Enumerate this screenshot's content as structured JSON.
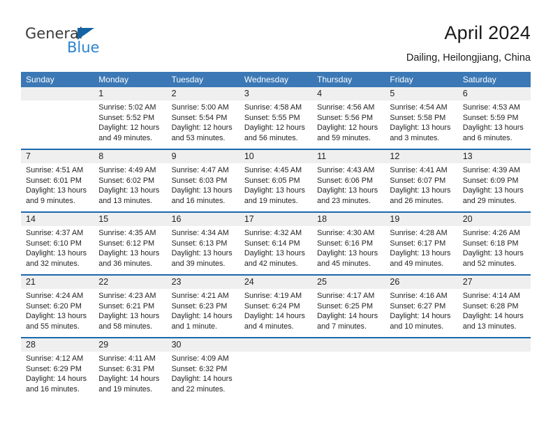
{
  "brand": {
    "name_top": "General",
    "name_bottom": "Blue",
    "triangle_color": "#1464a5",
    "blue_color": "#2a84d2"
  },
  "header": {
    "title": "April 2024",
    "subtitle": "Dailing, Heilongjiang, China"
  },
  "theme": {
    "header_bg": "#3b78b5",
    "row_divider": "#1b68ad",
    "daynum_bg": "#efefef",
    "text": "#222222"
  },
  "weekdays": [
    "Sunday",
    "Monday",
    "Tuesday",
    "Wednesday",
    "Thursday",
    "Friday",
    "Saturday"
  ],
  "weeks": [
    {
      "days": [
        {
          "num": "",
          "sunrise": "",
          "sunset": "",
          "daylight1": "",
          "daylight2": ""
        },
        {
          "num": "1",
          "sunrise": "Sunrise: 5:02 AM",
          "sunset": "Sunset: 5:52 PM",
          "daylight1": "Daylight: 12 hours",
          "daylight2": "and 49 minutes."
        },
        {
          "num": "2",
          "sunrise": "Sunrise: 5:00 AM",
          "sunset": "Sunset: 5:54 PM",
          "daylight1": "Daylight: 12 hours",
          "daylight2": "and 53 minutes."
        },
        {
          "num": "3",
          "sunrise": "Sunrise: 4:58 AM",
          "sunset": "Sunset: 5:55 PM",
          "daylight1": "Daylight: 12 hours",
          "daylight2": "and 56 minutes."
        },
        {
          "num": "4",
          "sunrise": "Sunrise: 4:56 AM",
          "sunset": "Sunset: 5:56 PM",
          "daylight1": "Daylight: 12 hours",
          "daylight2": "and 59 minutes."
        },
        {
          "num": "5",
          "sunrise": "Sunrise: 4:54 AM",
          "sunset": "Sunset: 5:58 PM",
          "daylight1": "Daylight: 13 hours",
          "daylight2": "and 3 minutes."
        },
        {
          "num": "6",
          "sunrise": "Sunrise: 4:53 AM",
          "sunset": "Sunset: 5:59 PM",
          "daylight1": "Daylight: 13 hours",
          "daylight2": "and 6 minutes."
        }
      ]
    },
    {
      "days": [
        {
          "num": "7",
          "sunrise": "Sunrise: 4:51 AM",
          "sunset": "Sunset: 6:01 PM",
          "daylight1": "Daylight: 13 hours",
          "daylight2": "and 9 minutes."
        },
        {
          "num": "8",
          "sunrise": "Sunrise: 4:49 AM",
          "sunset": "Sunset: 6:02 PM",
          "daylight1": "Daylight: 13 hours",
          "daylight2": "and 13 minutes."
        },
        {
          "num": "9",
          "sunrise": "Sunrise: 4:47 AM",
          "sunset": "Sunset: 6:03 PM",
          "daylight1": "Daylight: 13 hours",
          "daylight2": "and 16 minutes."
        },
        {
          "num": "10",
          "sunrise": "Sunrise: 4:45 AM",
          "sunset": "Sunset: 6:05 PM",
          "daylight1": "Daylight: 13 hours",
          "daylight2": "and 19 minutes."
        },
        {
          "num": "11",
          "sunrise": "Sunrise: 4:43 AM",
          "sunset": "Sunset: 6:06 PM",
          "daylight1": "Daylight: 13 hours",
          "daylight2": "and 23 minutes."
        },
        {
          "num": "12",
          "sunrise": "Sunrise: 4:41 AM",
          "sunset": "Sunset: 6:07 PM",
          "daylight1": "Daylight: 13 hours",
          "daylight2": "and 26 minutes."
        },
        {
          "num": "13",
          "sunrise": "Sunrise: 4:39 AM",
          "sunset": "Sunset: 6:09 PM",
          "daylight1": "Daylight: 13 hours",
          "daylight2": "and 29 minutes."
        }
      ]
    },
    {
      "days": [
        {
          "num": "14",
          "sunrise": "Sunrise: 4:37 AM",
          "sunset": "Sunset: 6:10 PM",
          "daylight1": "Daylight: 13 hours",
          "daylight2": "and 32 minutes."
        },
        {
          "num": "15",
          "sunrise": "Sunrise: 4:35 AM",
          "sunset": "Sunset: 6:12 PM",
          "daylight1": "Daylight: 13 hours",
          "daylight2": "and 36 minutes."
        },
        {
          "num": "16",
          "sunrise": "Sunrise: 4:34 AM",
          "sunset": "Sunset: 6:13 PM",
          "daylight1": "Daylight: 13 hours",
          "daylight2": "and 39 minutes."
        },
        {
          "num": "17",
          "sunrise": "Sunrise: 4:32 AM",
          "sunset": "Sunset: 6:14 PM",
          "daylight1": "Daylight: 13 hours",
          "daylight2": "and 42 minutes."
        },
        {
          "num": "18",
          "sunrise": "Sunrise: 4:30 AM",
          "sunset": "Sunset: 6:16 PM",
          "daylight1": "Daylight: 13 hours",
          "daylight2": "and 45 minutes."
        },
        {
          "num": "19",
          "sunrise": "Sunrise: 4:28 AM",
          "sunset": "Sunset: 6:17 PM",
          "daylight1": "Daylight: 13 hours",
          "daylight2": "and 49 minutes."
        },
        {
          "num": "20",
          "sunrise": "Sunrise: 4:26 AM",
          "sunset": "Sunset: 6:18 PM",
          "daylight1": "Daylight: 13 hours",
          "daylight2": "and 52 minutes."
        }
      ]
    },
    {
      "days": [
        {
          "num": "21",
          "sunrise": "Sunrise: 4:24 AM",
          "sunset": "Sunset: 6:20 PM",
          "daylight1": "Daylight: 13 hours",
          "daylight2": "and 55 minutes."
        },
        {
          "num": "22",
          "sunrise": "Sunrise: 4:23 AM",
          "sunset": "Sunset: 6:21 PM",
          "daylight1": "Daylight: 13 hours",
          "daylight2": "and 58 minutes."
        },
        {
          "num": "23",
          "sunrise": "Sunrise: 4:21 AM",
          "sunset": "Sunset: 6:23 PM",
          "daylight1": "Daylight: 14 hours",
          "daylight2": "and 1 minute."
        },
        {
          "num": "24",
          "sunrise": "Sunrise: 4:19 AM",
          "sunset": "Sunset: 6:24 PM",
          "daylight1": "Daylight: 14 hours",
          "daylight2": "and 4 minutes."
        },
        {
          "num": "25",
          "sunrise": "Sunrise: 4:17 AM",
          "sunset": "Sunset: 6:25 PM",
          "daylight1": "Daylight: 14 hours",
          "daylight2": "and 7 minutes."
        },
        {
          "num": "26",
          "sunrise": "Sunrise: 4:16 AM",
          "sunset": "Sunset: 6:27 PM",
          "daylight1": "Daylight: 14 hours",
          "daylight2": "and 10 minutes."
        },
        {
          "num": "27",
          "sunrise": "Sunrise: 4:14 AM",
          "sunset": "Sunset: 6:28 PM",
          "daylight1": "Daylight: 14 hours",
          "daylight2": "and 13 minutes."
        }
      ]
    },
    {
      "days": [
        {
          "num": "28",
          "sunrise": "Sunrise: 4:12 AM",
          "sunset": "Sunset: 6:29 PM",
          "daylight1": "Daylight: 14 hours",
          "daylight2": "and 16 minutes."
        },
        {
          "num": "29",
          "sunrise": "Sunrise: 4:11 AM",
          "sunset": "Sunset: 6:31 PM",
          "daylight1": "Daylight: 14 hours",
          "daylight2": "and 19 minutes."
        },
        {
          "num": "30",
          "sunrise": "Sunrise: 4:09 AM",
          "sunset": "Sunset: 6:32 PM",
          "daylight1": "Daylight: 14 hours",
          "daylight2": "and 22 minutes."
        },
        {
          "num": "",
          "sunrise": "",
          "sunset": "",
          "daylight1": "",
          "daylight2": ""
        },
        {
          "num": "",
          "sunrise": "",
          "sunset": "",
          "daylight1": "",
          "daylight2": ""
        },
        {
          "num": "",
          "sunrise": "",
          "sunset": "",
          "daylight1": "",
          "daylight2": ""
        },
        {
          "num": "",
          "sunrise": "",
          "sunset": "",
          "daylight1": "",
          "daylight2": ""
        }
      ]
    }
  ]
}
